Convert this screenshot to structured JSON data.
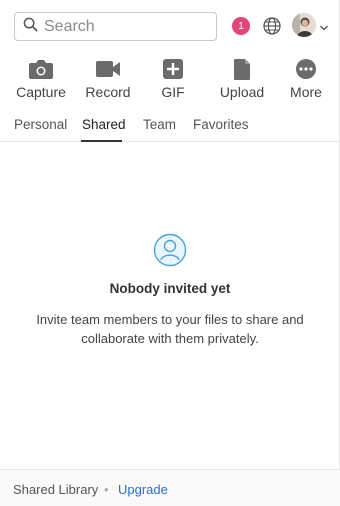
{
  "search": {
    "placeholder": "Search"
  },
  "header": {
    "notification_count": "1",
    "icons": [
      "search-icon",
      "globe-icon",
      "avatar",
      "chevron-down-icon"
    ]
  },
  "actions": [
    {
      "label": "Capture",
      "icon": "camera-icon"
    },
    {
      "label": "Record",
      "icon": "video-camera-icon"
    },
    {
      "label": "GIF",
      "icon": "gif-icon"
    },
    {
      "label": "Upload",
      "icon": "file-icon"
    },
    {
      "label": "More",
      "icon": "more-icon"
    }
  ],
  "tabs": [
    {
      "label": "Personal",
      "active": false
    },
    {
      "label": "Shared",
      "active": true
    },
    {
      "label": "Team",
      "active": false
    },
    {
      "label": "Favorites",
      "active": false
    }
  ],
  "empty_state": {
    "icon": "user-circle-icon",
    "title": "Nobody invited yet",
    "description": "Invite team members to your files to share and collaborate with them privately."
  },
  "footer": {
    "library_label": "Shared Library",
    "separator": "•",
    "upgrade_label": "Upgrade"
  },
  "colors": {
    "badge": "#e0457b",
    "link": "#2a6fd6",
    "icon_gray": "#6b6b6b",
    "empty_icon": "#4ba3d9"
  }
}
